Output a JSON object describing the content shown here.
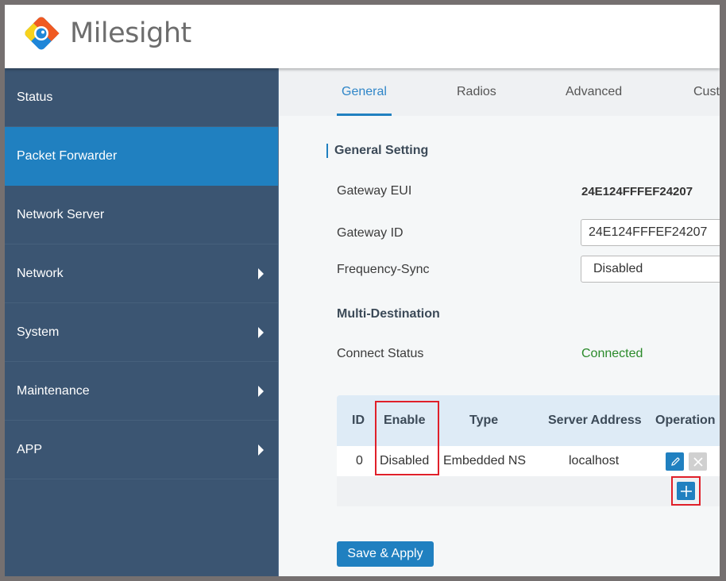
{
  "brand": {
    "name": "Milesight",
    "logo_icon": "milesight-logo-icon"
  },
  "sidebar": {
    "items": [
      {
        "label": "Status",
        "has_submenu": false,
        "active": false
      },
      {
        "label": "Packet Forwarder",
        "has_submenu": false,
        "active": true
      },
      {
        "label": "Network Server",
        "has_submenu": false,
        "active": false
      },
      {
        "label": "Network",
        "has_submenu": true,
        "active": false
      },
      {
        "label": "System",
        "has_submenu": true,
        "active": false
      },
      {
        "label": "Maintenance",
        "has_submenu": true,
        "active": false
      },
      {
        "label": "APP",
        "has_submenu": true,
        "active": false
      }
    ]
  },
  "tabs": [
    {
      "label": "General",
      "active": true
    },
    {
      "label": "Radios",
      "active": false
    },
    {
      "label": "Advanced",
      "active": false
    },
    {
      "label": "Cust",
      "active": false
    }
  ],
  "general": {
    "section_title": "General Setting",
    "gateway_eui_label": "Gateway EUI",
    "gateway_eui_value": "24E124FFFEF24207",
    "gateway_id_label": "Gateway ID",
    "gateway_id_value": "24E124FFFEF24207",
    "frequency_sync_label": "Frequency-Sync",
    "frequency_sync_value": "Disabled",
    "multi_destination_label": "Multi-Destination",
    "connect_status_label": "Connect Status",
    "connect_status_value": "Connected"
  },
  "destinations_table": {
    "columns": [
      "ID",
      "Enable",
      "Type",
      "Server Address",
      "Operation"
    ],
    "rows": [
      {
        "id": "0",
        "enable": "Disabled",
        "type": "Embedded NS",
        "server_address": "localhost"
      }
    ]
  },
  "actions": {
    "save_apply": "Save & Apply"
  },
  "colors": {
    "accent": "#2080c0",
    "sidebar_bg": "#3b5572",
    "status_connected": "#2a8a2a",
    "highlight": "#e0202a"
  }
}
